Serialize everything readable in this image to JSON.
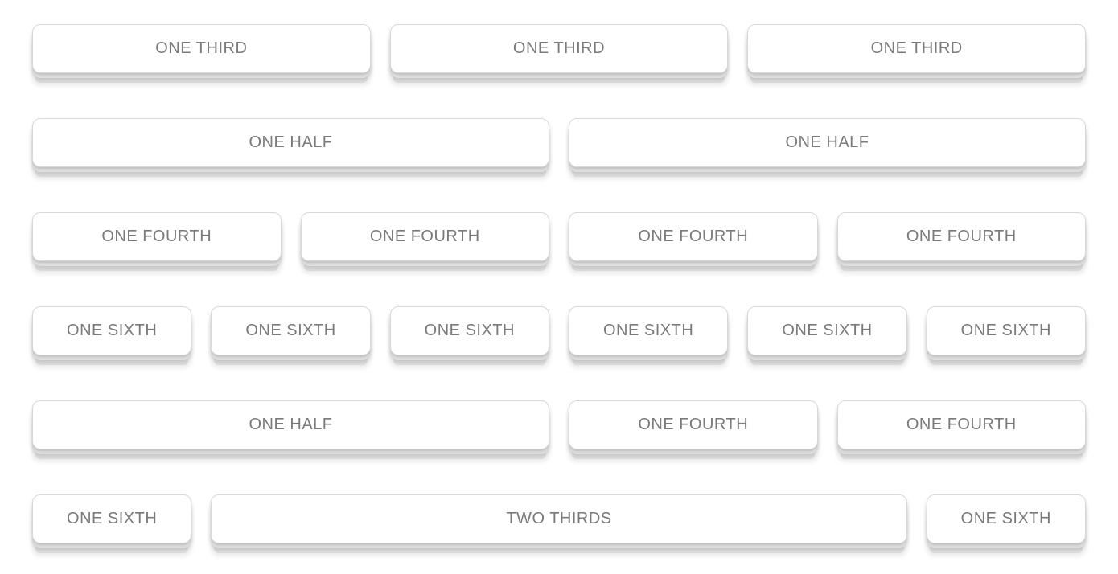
{
  "rows": [
    {
      "cells": [
        {
          "label": "ONE THIRD",
          "width": "third"
        },
        {
          "label": "ONE THIRD",
          "width": "third"
        },
        {
          "label": "ONE THIRD",
          "width": "third"
        }
      ]
    },
    {
      "cells": [
        {
          "label": "ONE HALF",
          "width": "half"
        },
        {
          "label": "ONE HALF",
          "width": "half"
        }
      ]
    },
    {
      "cells": [
        {
          "label": "ONE FOURTH",
          "width": "fourth"
        },
        {
          "label": "ONE FOURTH",
          "width": "fourth"
        },
        {
          "label": "ONE FOURTH",
          "width": "fourth"
        },
        {
          "label": "ONE FOURTH",
          "width": "fourth"
        }
      ]
    },
    {
      "cells": [
        {
          "label": "ONE SIXTH",
          "width": "sixth"
        },
        {
          "label": "ONE SIXTH",
          "width": "sixth"
        },
        {
          "label": "ONE SIXTH",
          "width": "sixth"
        },
        {
          "label": "ONE SIXTH",
          "width": "sixth"
        },
        {
          "label": "ONE SIXTH",
          "width": "sixth"
        },
        {
          "label": "ONE SIXTH",
          "width": "sixth"
        }
      ]
    },
    {
      "cells": [
        {
          "label": "ONE HALF",
          "width": "half"
        },
        {
          "label": "ONE FOURTH",
          "width": "fourth"
        },
        {
          "label": "ONE FOURTH",
          "width": "fourth"
        }
      ]
    },
    {
      "cells": [
        {
          "label": "ONE SIXTH",
          "width": "sixth"
        },
        {
          "label": "TWO THIRDS",
          "width": "twothirds"
        },
        {
          "label": "ONE SIXTH",
          "width": "sixth"
        }
      ]
    }
  ]
}
